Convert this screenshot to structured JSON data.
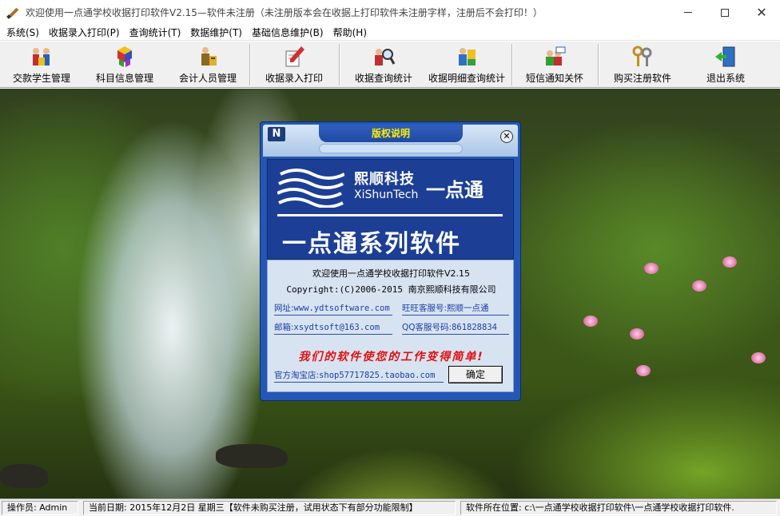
{
  "window": {
    "title": "欢迎使用一点通学校收据打印软件V2.15—软件未注册（未注册版本会在收据上打印软件未注册字样，注册后不会打印！）",
    "minimize_glyph": "—",
    "maximize_glyph": "☐",
    "close_glyph": "✕"
  },
  "menu": {
    "items": [
      {
        "label": "系统(S)"
      },
      {
        "label": "收据录入打印(P)"
      },
      {
        "label": "查询统计(T)"
      },
      {
        "label": "数据维护(T)"
      },
      {
        "label": "基础信息维护(B)"
      },
      {
        "label": "帮助(H)"
      }
    ]
  },
  "toolbar": {
    "buttons": [
      {
        "label": "交款学生管理",
        "icon": "students-icon"
      },
      {
        "label": "科目信息管理",
        "icon": "cubes-icon"
      },
      {
        "label": "会计人员管理",
        "icon": "accountant-icon"
      },
      {
        "label": "收据录入打印",
        "icon": "pen-paper-icon"
      },
      {
        "label": "收据查询统计",
        "icon": "magnifier-person-icon"
      },
      {
        "label": "收据明细查询统计",
        "icon": "detail-query-icon"
      },
      {
        "label": "短信通知关怀",
        "icon": "sms-users-icon"
      },
      {
        "label": "购买注册软件",
        "icon": "keys-icon"
      },
      {
        "label": "退出系统",
        "icon": "exit-door-icon"
      }
    ]
  },
  "dialog": {
    "title": "版权说明",
    "logo_glyph": "N",
    "close_glyph": "✕",
    "brand_cn": "熙顺科技",
    "brand_en": "XiShunTech",
    "product_name": "一点通",
    "series": "一点通系列软件",
    "welcome": "欢迎使用一点通学校收据打印软件V2.15",
    "copyright": "Copyright:(C)2006-2015 南京熙顺科技有限公司",
    "website_label": "网址:",
    "website": "www.ydtsoftware.com",
    "wangwang_label": "旺旺客服号:",
    "wangwang": "熙顺一点通",
    "email_label": "邮箱:",
    "email": "xsydtsoft@163.com",
    "qq_label": "QQ客服号码:",
    "qq": "861828834",
    "slogan": "我们的软件使您的工作变得简单!",
    "taobao_label": "官方淘宝店:",
    "taobao": "shop57717825.taobao.com",
    "ok_label": "确定"
  },
  "status": {
    "operator": "操作员: Admin",
    "date": "当前日期: 2015年12月2日 星期三【软件未购买注册，试用状态下有部分功能限制】",
    "path": "软件所在位置: c:\\一点通学校收据打印软件\\一点通学校收据打印软件."
  },
  "colors": {
    "dialog_blue": "#2456b6",
    "banner_blue": "#1c3f95",
    "slogan_red": "#e01010",
    "tab_text_yellow": "#ffef00"
  }
}
